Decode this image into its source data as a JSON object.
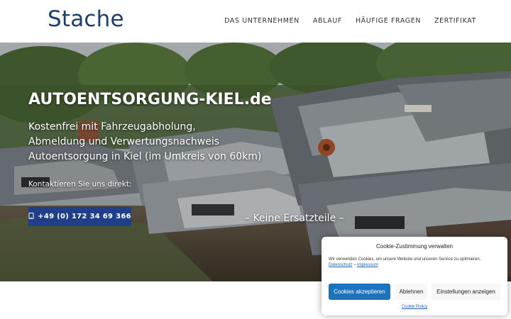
{
  "header": {
    "logo": "Stache",
    "nav": [
      "DAS UNTERNEHMEN",
      "ABLAUF",
      "HÄUFIGE FRAGEN",
      "ZERTIFIKAT"
    ]
  },
  "hero": {
    "title": "AUTOENTSORGUNG-KIEL.de",
    "lines": [
      "Kostenfrei mit Fahrzeugabholung,",
      "Abmeldung und Verwertungsnachweis",
      "Autoentsorgung in Kiel (im Umkreis von 60km)"
    ],
    "contact_label": "Kontaktieren Sie uns direkt:",
    "phone": "+49 (0) 172 34 69 366",
    "phone_icon": "phone-icon",
    "tagline": "– Keine Ersatzteile –",
    "background": "car-scrapyard-photo"
  },
  "cookie": {
    "title": "Cookie-Zustimmung verwalten",
    "text": "Wir verwenden Cookies, um unsere Website und unseren Service zu optimieren.",
    "link_privacy": "Datenschutz",
    "link_separator": "–",
    "link_imprint": "Impressum",
    "accept": "Cookies akzeptieren",
    "deny": "Ablehnen",
    "settings": "Einstellungen anzeigen",
    "policy": "Cookie Policy"
  },
  "colors": {
    "brand": "#1d3f6e",
    "phone_button": "#1f3f8a",
    "accept_button": "#1e73be"
  }
}
